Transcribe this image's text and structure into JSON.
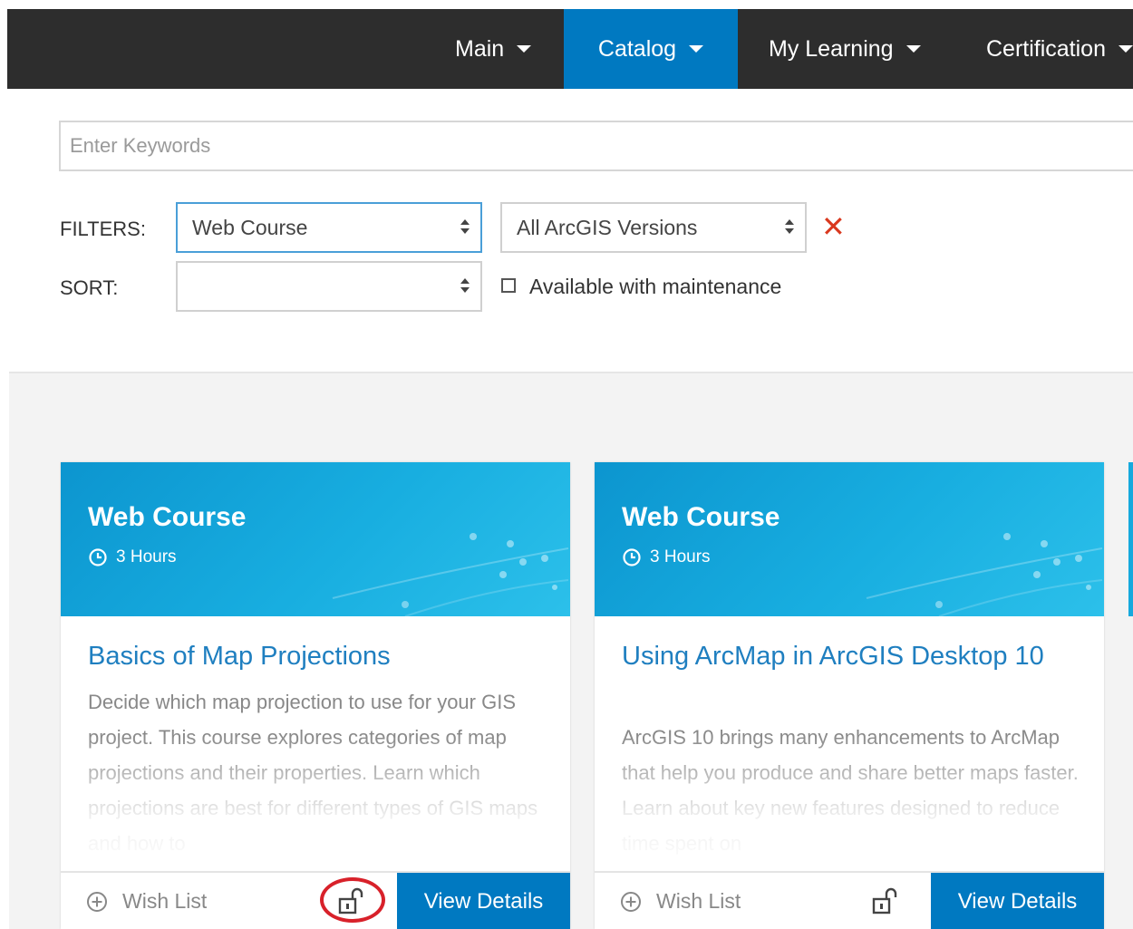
{
  "nav": {
    "items": [
      {
        "label": "Main"
      },
      {
        "label": "Catalog"
      },
      {
        "label": "My Learning"
      },
      {
        "label": "Certification"
      }
    ],
    "active": "Catalog"
  },
  "search": {
    "placeholder": "Enter Keywords",
    "value": ""
  },
  "filters": {
    "label": "FILTERS:",
    "type_selected": "Web Course",
    "version_selected": "All ArcGIS Versions",
    "clear_symbol": "✕"
  },
  "sort": {
    "label": "SORT:",
    "selected": "",
    "maintenance_label": "Available with maintenance",
    "maintenance_checked": false
  },
  "cards": [
    {
      "type": "Web Course",
      "duration": "3 Hours",
      "title": "Basics of Map Projections",
      "description": "Decide which map projection to use for your GIS project. This course explores categories of map projections and their properties. Learn which projections are best for different types of GIS maps and how to",
      "wish_label": "Wish List",
      "lock_icon": "unlocked-padlock-icon",
      "button_label": "View Details",
      "lock_highlighted": true
    },
    {
      "type": "Web Course",
      "duration": "3 Hours",
      "title": "Using ArcMap in ArcGIS Desktop 10",
      "description": "ArcGIS 10 brings many enhancements to ArcMap that help you produce and share better maps faster. Learn about key new features designed to reduce time spent on",
      "wish_label": "Wish List",
      "lock_icon": "unlocked-padlock-icon",
      "button_label": "View Details",
      "lock_highlighted": false
    }
  ],
  "colors": {
    "nav_bg": "#2d2d2d",
    "accent": "#0079c1",
    "card_header": "#18aee0",
    "title_link": "#1f7fc0",
    "clear_red": "#d9381e",
    "highlight_red": "#d8212a"
  }
}
